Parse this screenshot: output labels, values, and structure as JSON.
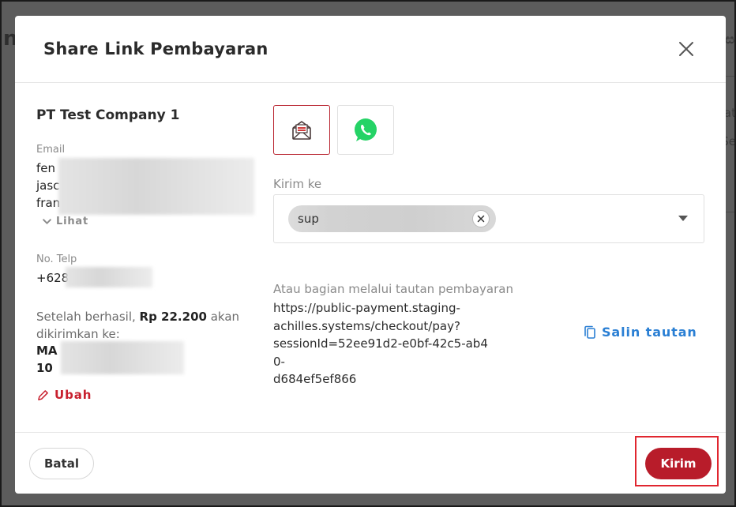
{
  "modal": {
    "title": "Share Link Pembayaran"
  },
  "customer": {
    "company": "PT Test Company 1",
    "email_label": "Email",
    "email_lines": [
      "fen",
      "jasc",
      "fran"
    ],
    "lihat_label": "Lihat",
    "phone_label": "No. Telp",
    "phone_value": "+628",
    "note_prefix": "Setelah berhasil,",
    "note_amount": "Rp 22.200",
    "note_suffix": "akan dikirimkan ke:",
    "recipient_lines": [
      "MA",
      "10"
    ],
    "ubah_label": "Ubah"
  },
  "channels": [
    {
      "name": "email",
      "icon": "envelope-icon",
      "selected": true
    },
    {
      "name": "whatsapp",
      "icon": "whatsapp-icon",
      "selected": false
    }
  ],
  "send_to": {
    "label": "Kirim ke",
    "chip_text": "sup"
  },
  "share": {
    "label": "Atau bagian melalui tautan pembayaran",
    "url": "https://public-payment.staging-achilles.systems/checkout/pay?sessionId=52ee91d2-e0bf-42c5-ab40-d684ef5ef866",
    "url_lines": [
      "https://public-payment.staging-",
      "achilles.systems/checkout/pay?",
      "sessionId=52ee91d2-e0bf-42c5-ab40-",
      "d684ef5ef866"
    ],
    "copy_label": "Salin tautan"
  },
  "footer": {
    "cancel_label": "Batal",
    "submit_label": "Kirim"
  },
  "colors": {
    "primary": "#b81c2a",
    "link": "#2a7fd4",
    "whatsapp": "#25d366"
  }
}
